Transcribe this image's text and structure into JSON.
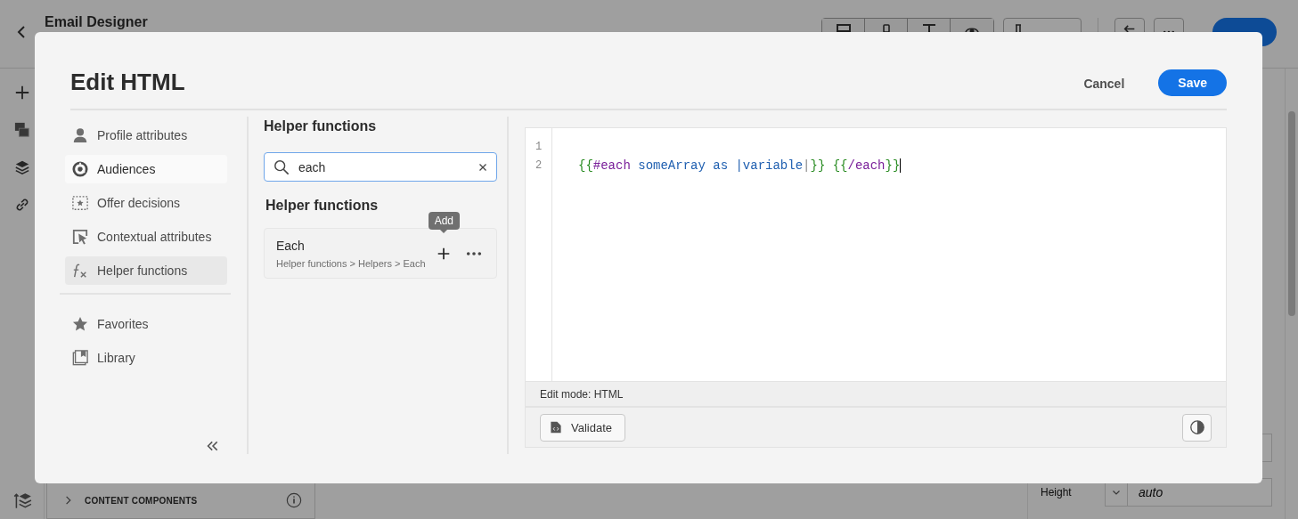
{
  "app": {
    "title": "Email Designer",
    "toolbar": [
      {
        "kind": "desktop"
      },
      {
        "kind": "mobile"
      },
      {
        "kind": "text"
      },
      {
        "kind": "eye"
      }
    ],
    "rail": [
      {
        "kind": "plus"
      },
      {
        "kind": "image"
      },
      {
        "kind": "layers"
      },
      {
        "kind": "link"
      }
    ],
    "content_panel": {
      "label": "CONTENT COMPONENTS"
    },
    "properties": {
      "height_label": "Height",
      "height_placeholder": "auto"
    }
  },
  "dialog": {
    "title": "Edit HTML",
    "cancel_label": "Cancel",
    "save_label": "Save",
    "nav": [
      {
        "kind": "person",
        "label": "Profile attributes",
        "selected": false,
        "hovered": false
      },
      {
        "kind": "audience",
        "label": "Audiences",
        "selected": false,
        "hovered": true
      },
      {
        "kind": "offer",
        "label": "Offer decisions",
        "selected": false,
        "hovered": false
      },
      {
        "kind": "context",
        "label": "Contextual attributes",
        "selected": false,
        "hovered": false
      },
      {
        "kind": "fx",
        "label": "Helper functions",
        "selected": true,
        "hovered": false
      }
    ],
    "nav_bottom": [
      {
        "kind": "star",
        "label": "Favorites",
        "selected": false,
        "hovered": false
      },
      {
        "kind": "library",
        "label": "Library",
        "selected": false,
        "hovered": false
      }
    ],
    "panel": {
      "title": "Helper functions",
      "search": {
        "value": "each"
      },
      "section_title": "Helper functions",
      "results": [
        {
          "name": "Each",
          "path": "Helper functions > Helpers > Each",
          "tooltip": "Add"
        }
      ]
    },
    "editor": {
      "lines": [
        {
          "number": "1"
        },
        {
          "number": "2",
          "tokens": [
            {
              "kind": "brace",
              "text": "{{"
            },
            {
              "kind": "keyword",
              "text": "#each"
            },
            {
              "kind": "name",
              "text": " someArray as "
            },
            {
              "kind": "match",
              "text": "|"
            },
            {
              "kind": "name",
              "text": "variable"
            },
            {
              "kind": "pipe",
              "text": "|"
            },
            {
              "kind": "brace",
              "text": "}} "
            },
            {
              "kind": "brace",
              "text": "{{"
            },
            {
              "kind": "keyword",
              "text": "/each"
            },
            {
              "kind": "brace",
              "text": "}}"
            }
          ],
          "cursor": true
        }
      ],
      "status": "Edit mode: HTML",
      "validate_label": "Validate"
    }
  }
}
